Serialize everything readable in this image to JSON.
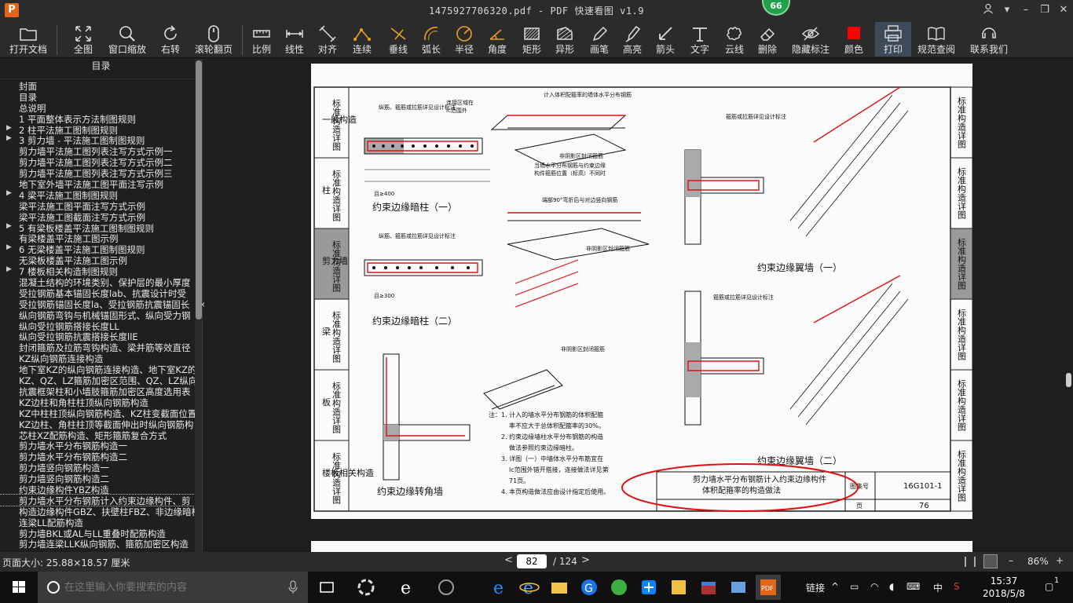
{
  "window": {
    "title": "1475927706320.pdf - PDF 快速看图 v1.9",
    "logo": "P",
    "badge": "66"
  },
  "toolbar": [
    {
      "label": "打开文档",
      "icon": "folder-icon"
    },
    {
      "label": "全图",
      "icon": "fit-all-icon"
    },
    {
      "label": "窗口缩放",
      "icon": "zoom-icon"
    },
    {
      "label": "右转",
      "icon": "rotate-right-icon"
    },
    {
      "label": "滚轮翻页",
      "icon": "mouse-wheel-icon"
    },
    {
      "label": "比例",
      "icon": "scale-icon"
    },
    {
      "label": "线性",
      "icon": "linear-dimension-icon"
    },
    {
      "label": "对齐",
      "icon": "aligned-dimension-icon"
    },
    {
      "label": "连续",
      "icon": "continuous-dimension-icon"
    },
    {
      "label": "垂线",
      "icon": "perpendicular-icon"
    },
    {
      "label": "弧长",
      "icon": "arc-length-icon"
    },
    {
      "label": "半径",
      "icon": "radius-icon"
    },
    {
      "label": "角度",
      "icon": "angle-icon"
    },
    {
      "label": "矩形",
      "icon": "rectangle-icon"
    },
    {
      "label": "异形",
      "icon": "polygon-icon"
    },
    {
      "label": "画笔",
      "icon": "pen-icon"
    },
    {
      "label": "高亮",
      "icon": "highlighter-icon"
    },
    {
      "label": "箭头",
      "icon": "arrow-icon"
    },
    {
      "label": "文字",
      "icon": "text-icon"
    },
    {
      "label": "云线",
      "icon": "cloud-line-icon"
    },
    {
      "label": "删除",
      "icon": "eraser-icon"
    },
    {
      "label": "隐藏标注",
      "icon": "eye-hide-icon"
    },
    {
      "label": "颜色",
      "icon": "color-swatch-icon",
      "color": "#ff0000"
    },
    {
      "label": "打印",
      "icon": "print-icon"
    },
    {
      "label": "规范查阅",
      "icon": "book-search-icon"
    },
    {
      "label": "联系我们",
      "icon": "contact-icon"
    }
  ],
  "sidebar": {
    "title": "目录",
    "items": [
      {
        "label": "封面",
        "arrow": false
      },
      {
        "label": "目录",
        "arrow": false
      },
      {
        "label": "总说明",
        "arrow": false
      },
      {
        "label": "1 平面整体表示方法制图规则",
        "arrow": false
      },
      {
        "label": "2 柱平法施工图制图规则",
        "arrow": true
      },
      {
        "label": "3 剪力墙 - 平法施工图制图规则",
        "arrow": true
      },
      {
        "label": "剪力墙平法施工图列表注写方式示例一",
        "arrow": false
      },
      {
        "label": "剪力墙平法施工图列表注写方式示例二",
        "arrow": false
      },
      {
        "label": "剪力墙平法施工图列表注写方式示例三",
        "arrow": false
      },
      {
        "label": "地下室外墙平法施工图平面注写示例",
        "arrow": false
      },
      {
        "label": "4 梁平法施工图制图规则",
        "arrow": true
      },
      {
        "label": "梁平法施工图平面注写方式示例",
        "arrow": false
      },
      {
        "label": "梁平法施工图截面注写方式示例",
        "arrow": false
      },
      {
        "label": "5 有梁板楼盖平法施工图制图规则",
        "arrow": true
      },
      {
        "label": "有梁楼盖平法施工图示例",
        "arrow": false
      },
      {
        "label": "6 无梁楼盖平法施工图制图规则",
        "arrow": true
      },
      {
        "label": "无梁板楼盖平法施工图示例",
        "arrow": false
      },
      {
        "label": "7 楼板相关构造制图规则",
        "arrow": true
      },
      {
        "label": "混凝土结构的环境类别、保护层的最小厚度",
        "arrow": false
      },
      {
        "label": "受拉钢筋基本锚固长度lab、抗震设计时受",
        "arrow": false
      },
      {
        "label": "受拉钢筋锚固长度la、受拉钢筋抗震锚固长",
        "arrow": false
      },
      {
        "label": "纵向钢筋弯钩与机械锚固形式、纵向受力钢",
        "arrow": false
      },
      {
        "label": "纵向受拉钢筋搭接长度LL",
        "arrow": false
      },
      {
        "label": "纵向受拉钢筋抗震搭接长度llE",
        "arrow": false
      },
      {
        "label": "封闭箍筋及拉筋弯钩构造、梁并筋等效直径",
        "arrow": false
      },
      {
        "label": "KZ纵向钢筋连接构造",
        "arrow": false
      },
      {
        "label": "地下室KZ的纵向钢筋连接构造、地下室KZ的",
        "arrow": false
      },
      {
        "label": "KZ、QZ、LZ箍筋加密区范围、QZ、LZ纵向钢筋",
        "arrow": false
      },
      {
        "label": "抗震框架柱和小墙肢箍筋加密区高度选用表",
        "arrow": false
      },
      {
        "label": "KZ边柱和角柱柱顶纵向钢筋构造",
        "arrow": false
      },
      {
        "label": "KZ中柱柱顶纵向钢筋构造、KZ柱变截面位置",
        "arrow": false
      },
      {
        "label": "KZ边柱、角柱柱顶等截面伸出时纵向钢筋构",
        "arrow": false
      },
      {
        "label": "芯柱XZ配筋构造、矩形箍筋复合方式",
        "arrow": false
      },
      {
        "label": "剪力墙水平分布钢筋构造一",
        "arrow": false
      },
      {
        "label": "剪力墙水平分布钢筋构造二",
        "arrow": false
      },
      {
        "label": "剪力墙竖向钢筋构造一",
        "arrow": false
      },
      {
        "label": "剪力墙竖向钢筋构造二",
        "arrow": false
      },
      {
        "label": "约束边缘构件YBZ构造",
        "arrow": false
      },
      {
        "label": "剪力墙水平分布钢筋计入约束边缘构件、剪",
        "arrow": false,
        "selected": true
      },
      {
        "label": "构造边缘构件GBZ、扶壁柱FBZ、非边缘暗柱",
        "arrow": false
      },
      {
        "label": "连梁LL配筋构造",
        "arrow": false
      },
      {
        "label": "剪力墙BKL或AL与LL重叠时配筋构造",
        "arrow": false
      },
      {
        "label": "剪力墙连梁LLK纵向钢筋、箍筋加密区构造",
        "arrow": false
      }
    ]
  },
  "drawing": {
    "left_tabs": [
      {
        "label": "标准构造详图",
        "prefix": "一般构造"
      },
      {
        "label": "标准构造详图",
        "prefix": "柱"
      },
      {
        "label": "标准构造详图",
        "prefix": "剪力墙"
      },
      {
        "label": "标准构造详图",
        "prefix": "梁"
      },
      {
        "label": "标准构造详图",
        "prefix": "板"
      },
      {
        "label": "标准构造详图",
        "prefix": "楼板相关构造"
      }
    ],
    "right_tabs": [
      "标准构造详图",
      "标准构造详图",
      "标准构造详图",
      "标准构造详图",
      "标准构造详图",
      "标准构造详图"
    ],
    "captions": {
      "c1": "约束边缘暗柱（一）",
      "c2": "约束边缘暗柱（二）",
      "c3": "约束边缘转角墙",
      "c4": "约束边缘翼墙（一）",
      "c5": "约束边缘翼墙（二）"
    },
    "annotations": {
      "a1": "纵筋、箍筋或拉筋详见设计标注",
      "a2": "连接区域在",
      "a3": "lc范围外",
      "a4": "计入体积配箍率的墙体水平分布钢筋",
      "a5": "非阴影区封闭箍筋",
      "a6": "当墙水平分布钢筋与约束边缘",
      "a7": "构件箍筋位置（标高）不同时",
      "a8": "箍筋或拉筋详见设计标注",
      "a9": "端部90°弯折后与对边竖向钢筋",
      "a10": "非阴影区封闭箍筋",
      "a11": "纵筋、箍筋或拉筋详见设计标注",
      "a12": "箍筋或拉筋详见设计标注",
      "a13": "且≥400",
      "a14": "且≥300",
      "a15": "非阴影区封闭箍筋"
    },
    "notes": {
      "n1": "注：1. 计入的墙水平分布钢筋的体积配箍",
      "n2": "率不应大于总体积配箍率的30%。",
      "n3": "2. 约束边缘墙柱水平分布钢筋的构造",
      "n4": "做法参照约束边缘暗柱。",
      "n5": "3. 详图（一）中墙体水平分布筋宜在",
      "n6": "lc范围外错开搭接，连接做法详见第",
      "n7": "71页。",
      "n8": "4. 本页构造做法应由设计指定后使用。"
    },
    "title_block": {
      "line1": "剪力墙水平分布钢筋计入约束边缘构件",
      "line2": "体积配箍率的构造做法",
      "atlas_label": "图集号",
      "atlas_no": "16G101-1",
      "page_label": "页",
      "page_no": "76"
    },
    "highlight_color": "#e01010"
  },
  "status": {
    "page_size": "页面大小: 25.88×18.57 厘米",
    "current_page": "82",
    "total_pages": "/ 124",
    "prev": "<",
    "next": ">",
    "zoom": "86%"
  },
  "taskbar": {
    "search_placeholder": "在这里输入你要搜索的内容",
    "link_label": "链接",
    "ime": "中",
    "time": "15:37",
    "date": "2018/5/8",
    "notifications": "1"
  }
}
